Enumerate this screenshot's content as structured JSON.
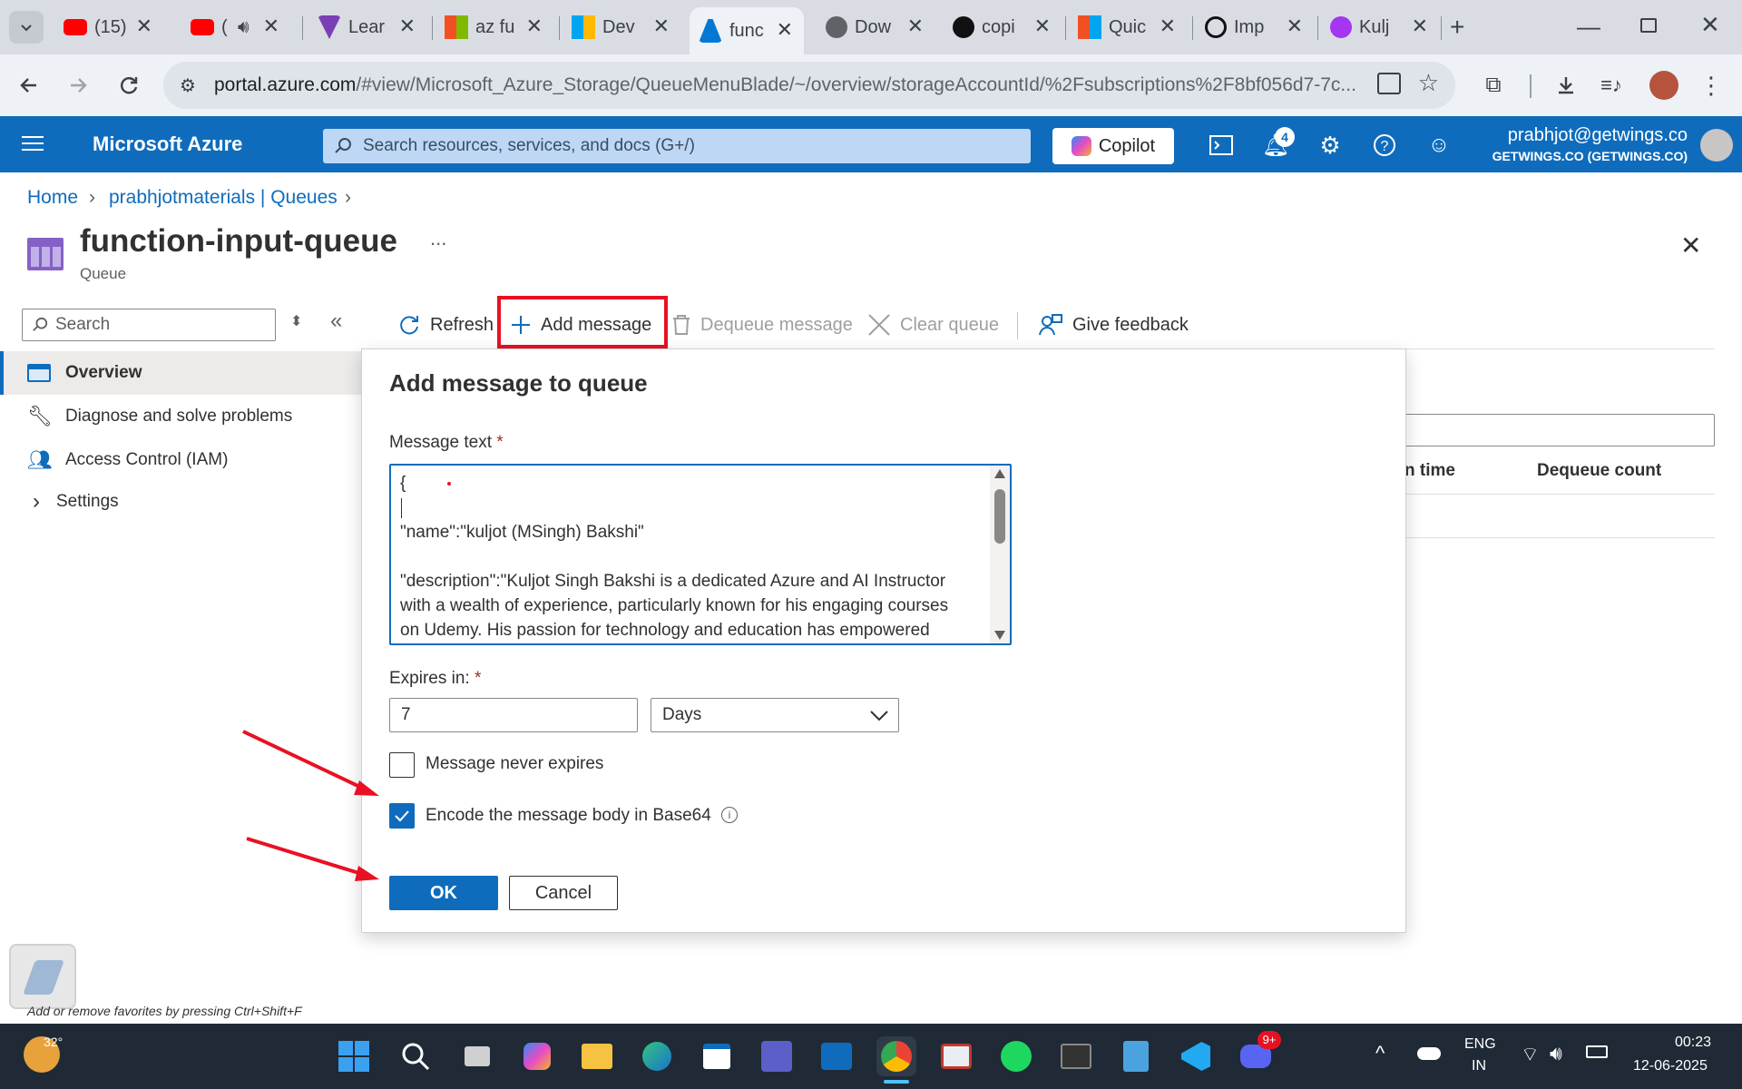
{
  "browser": {
    "tabs": [
      {
        "title": "(15)",
        "icon": "youtube-icon",
        "color": "#ff0000"
      },
      {
        "title": "(",
        "icon": "youtube-icon",
        "color": "#ff0000",
        "audio": true
      },
      {
        "title": "Lear",
        "icon": "learn-icon",
        "color": "#5b2d90"
      },
      {
        "title": "az fu",
        "icon": "microsoft-icon",
        "color": "#f25022"
      },
      {
        "title": "Dev",
        "icon": "microsoft-icon",
        "color": "#f25022"
      },
      {
        "title": "func",
        "icon": "azure-icon",
        "color": "#0078d4",
        "active": true
      },
      {
        "title": "Dow",
        "icon": "globe-icon",
        "color": "#5f6368"
      },
      {
        "title": "copi",
        "icon": "github-icon",
        "color": "#000000"
      },
      {
        "title": "Quic",
        "icon": "microsoft-icon",
        "color": "#f25022"
      },
      {
        "title": "Imp",
        "icon": "openai-icon",
        "color": "#000000"
      },
      {
        "title": "Kulj",
        "icon": "udemy-icon",
        "color": "#a435f0"
      }
    ],
    "url_host": "portal.azure.com",
    "url_path": "/#view/Microsoft_Azure_Storage/QueueMenuBlade/~/overview/storageAccountId/%2Fsubscriptions%2F8bf056d7-7c..."
  },
  "azure": {
    "brand": "Microsoft Azure",
    "search_placeholder": "Search resources, services, and docs (G+/)",
    "copilot_label": "Copilot",
    "notification_count": "4",
    "user_email": "prabhjot@getwings.co",
    "user_tenant": "GETWINGS.CO (GETWINGS.CO)"
  },
  "breadcrumb": {
    "home": "Home",
    "parent": "prabhjotmaterials | Queues"
  },
  "page": {
    "title": "function-input-queue",
    "subtitle": "Queue",
    "more": "..."
  },
  "sidebar": {
    "search_placeholder": "Search",
    "items": [
      {
        "label": "Overview",
        "icon": "queue-icon",
        "selected": true
      },
      {
        "label": "Diagnose and solve problems",
        "icon": "wrench-icon"
      },
      {
        "label": "Access Control (IAM)",
        "icon": "people-icon"
      },
      {
        "label": "Settings",
        "icon": "chevron-right-icon"
      }
    ]
  },
  "commands": {
    "refresh": "Refresh",
    "add_message": "Add message",
    "dequeue_message": "Dequeue message",
    "clear_queue": "Clear queue",
    "give_feedback": "Give feedback"
  },
  "background_table": {
    "col_time": "n time",
    "col_dequeue": "Dequeue count"
  },
  "dialog": {
    "title": "Add message to queue",
    "message_label": "Message text",
    "message_text": "{\n\n\"name\":\"kuljot (MSingh) Bakshi\"\n\n\"description\":\"Kuljot Singh Bakshi is a dedicated Azure and AI Instructor with a wealth of experience, particularly known for his engaging courses on Udemy. His passion for technology and education has empowered",
    "expires_label": "Expires in:",
    "expires_value": "7",
    "expires_unit": "Days",
    "never_expires_label": "Message never expires",
    "never_expires_checked": false,
    "encode_label": "Encode the message body in Base64",
    "encode_checked": true,
    "ok": "OK",
    "cancel": "Cancel"
  },
  "favorites_hint": "Add or remove favorites by pressing Ctrl+Shift+F",
  "taskbar": {
    "weather": "32°",
    "lang_top": "ENG",
    "lang_bottom": "IN",
    "time": "00:23",
    "date": "12-06-2025",
    "discord_badge": "9+"
  },
  "colors": {
    "accent": "#0f6cbd",
    "annotation_red": "#e81123"
  }
}
